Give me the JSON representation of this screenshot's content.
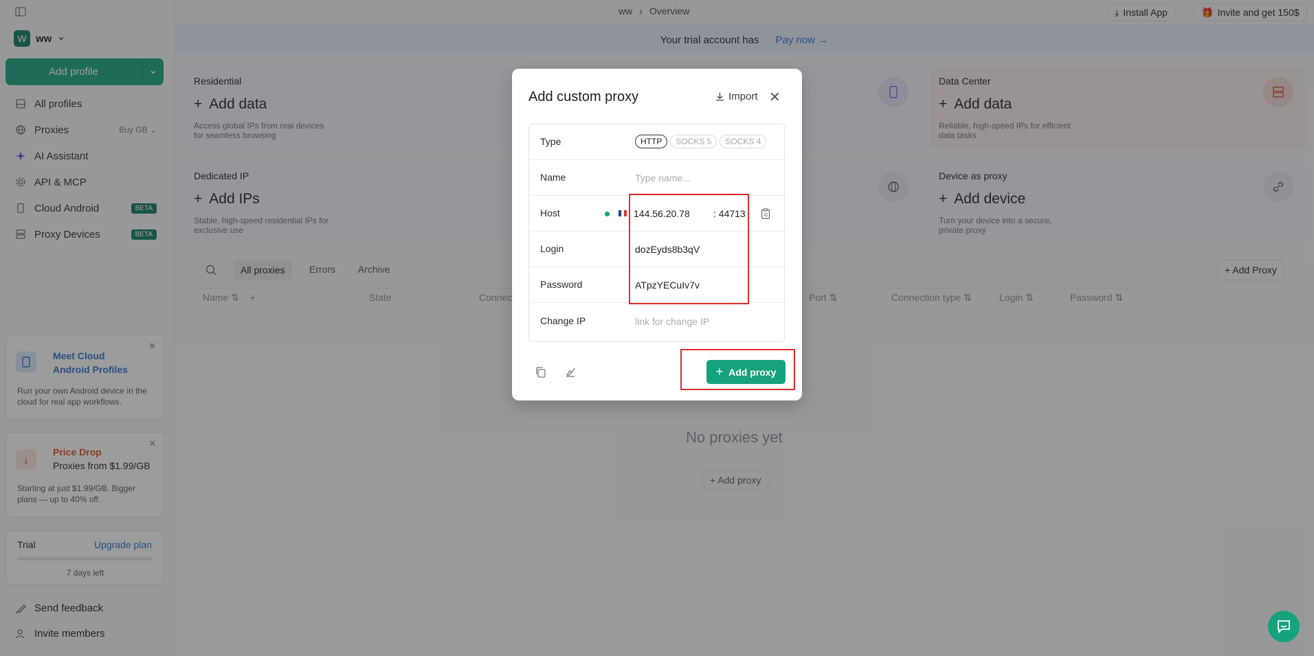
{
  "workspace": {
    "badge": "W",
    "name": "ww"
  },
  "sidebar": {
    "add_profile": "Add profile",
    "items": [
      {
        "label": "All profiles"
      },
      {
        "label": "Proxies",
        "extra": "Buy GB"
      },
      {
        "label": "AI Assistant"
      },
      {
        "label": "API & MCP"
      },
      {
        "label": "Cloud Android",
        "badge": "BETA"
      },
      {
        "label": "Proxy Devices",
        "badge": "BETA"
      }
    ],
    "promo1": {
      "title": "Meet Cloud Android Profiles",
      "desc": "Run your own Android device in the cloud for real app workflows."
    },
    "promo2": {
      "title": "Price Drop",
      "subtitle": "Proxies from $1.99/GB",
      "desc": "Starting at just $1.99/GB. Bigger plans — up to 40% off."
    },
    "trial": {
      "label": "Trial",
      "upgrade": "Upgrade plan",
      "days": "7 days left"
    },
    "feedback": "Send feedback",
    "invite": "Invite members"
  },
  "header": {
    "crumb1": "ww",
    "crumb2": "Overview",
    "install": "Install App",
    "invite": "Invite and get 150$"
  },
  "banner": {
    "text": "Your trial account has",
    "link": "Pay now"
  },
  "cards": {
    "residential": {
      "title": "Residential",
      "action": "Add data",
      "desc": "Access global IPs from real devices for seamless browsing"
    },
    "datacenter": {
      "title": "Data Center",
      "action": "Add data",
      "desc": "Reliable, high-speed IPs for efficient data tasks"
    },
    "dedicated": {
      "title": "Dedicated IP",
      "action": "Add IPs",
      "desc": "Stable, high-speed residential IPs for exclusive use"
    },
    "device": {
      "title": "Device as proxy",
      "action": "Add device",
      "desc": "Turn your device into a secure, private proxy"
    }
  },
  "tabs": [
    "All proxies",
    "Errors",
    "Archive"
  ],
  "add_proxy_top": "Add Proxy",
  "columns": [
    "Name",
    "State",
    "Connec",
    "Port",
    "Connection type",
    "Login",
    "Password"
  ],
  "empty": {
    "text": "No proxies yet",
    "button": "Add proxy"
  },
  "modal": {
    "title": "Add custom proxy",
    "import": "Import",
    "type_label": "Type",
    "types": [
      "HTTP",
      "SOCKS 5",
      "SOCKS 4"
    ],
    "name_label": "Name",
    "name_placeholder": "Type name...",
    "host_label": "Host",
    "host": "144.56.20.78",
    "port": ": 44713",
    "login_label": "Login",
    "login": "dozEyds8b3qV",
    "password_label": "Password",
    "password": "ATpzYECuIv7v",
    "change_ip_label": "Change IP",
    "change_ip_placeholder": "link for change IP",
    "submit": "Add proxy"
  }
}
